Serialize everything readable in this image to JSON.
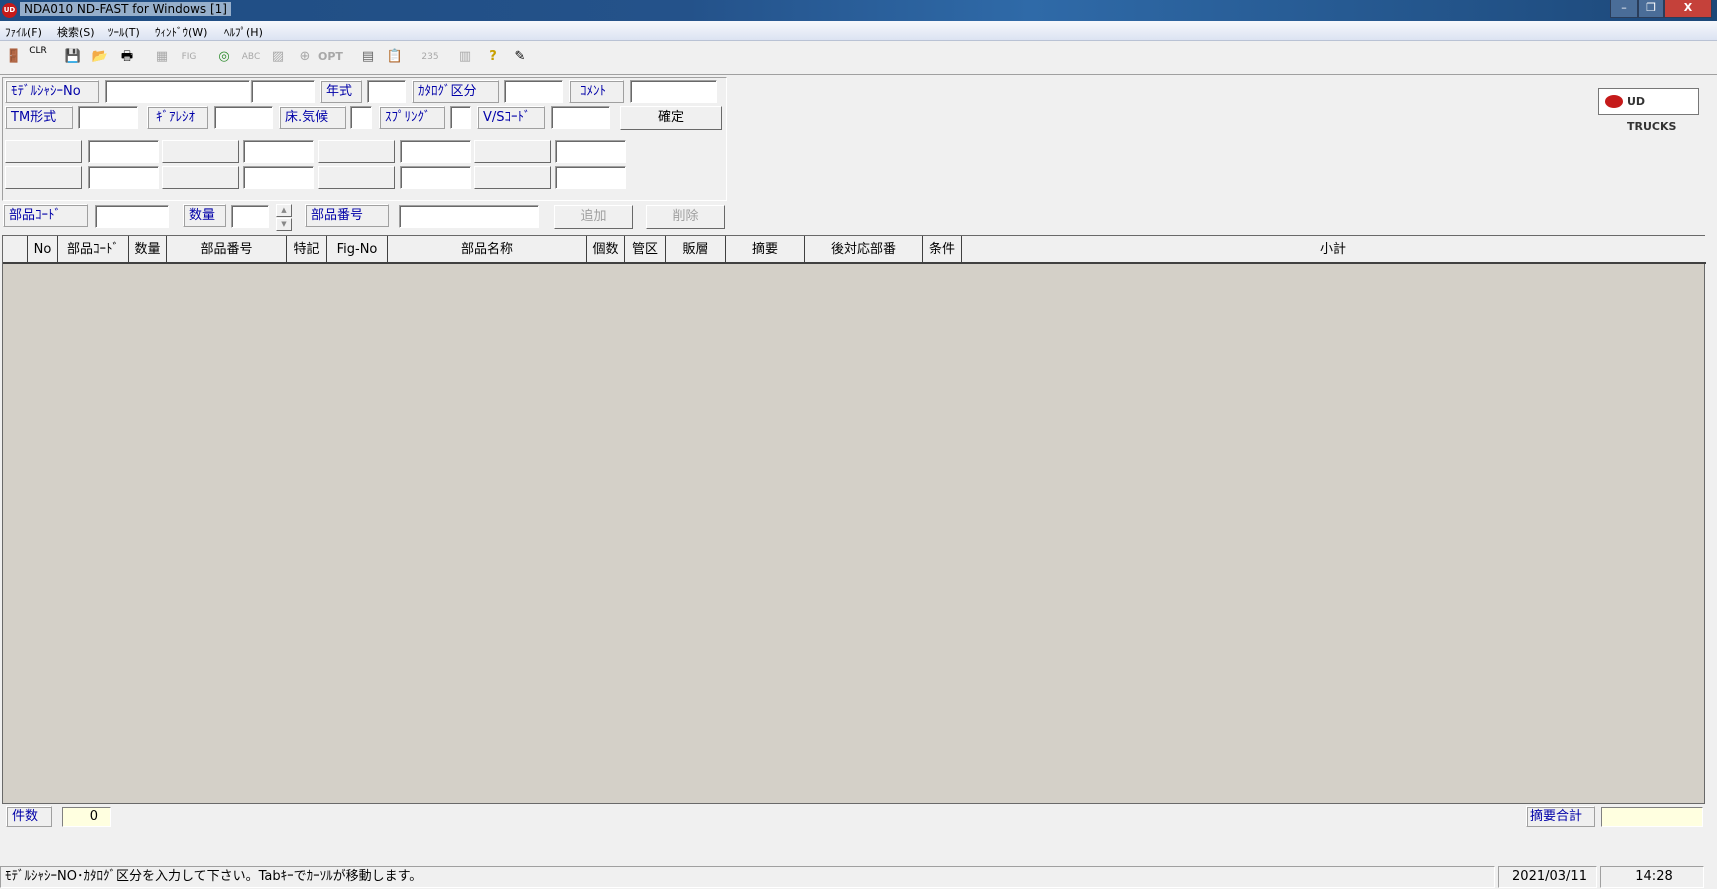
{
  "window": {
    "title": "NDA010 ND-FAST for Windows [1]",
    "app_icon": "UD",
    "minimize": "–",
    "restore": "❐",
    "close": "X"
  },
  "menu": [
    "ﾌｧｲﾙ(F)",
    "検索(S)",
    "ﾂｰﾙ(T)",
    "ｳｨﾝﾄﾞｳ(W)",
    "ﾍﾙﾌﾟ(H)"
  ],
  "toolbar": {
    "clr": "CLR",
    "abc": "ABC",
    "opt": "OPT",
    "num": "235",
    "logo": "UD TRUCKS"
  },
  "form": {
    "model_chassis_label": "ﾓﾃﾞﾙｼｬｼｰNo",
    "model_chassis_value": "",
    "model_chassis_value2": "",
    "year_label": "年式",
    "year_value": "",
    "catalog_label": "ｶﾀﾛｸﾞ区分",
    "catalog_value": "",
    "comment_label": "ｺﾒﾝﾄ",
    "comment_value": "",
    "tm_label": "TM形式",
    "tm_value": "",
    "gear_label": "ｷﾞｱﾚｼｵ",
    "gear_value": "",
    "floor_label": "床.気候",
    "floor_value": "",
    "spring_label": "ｽﾌﾟﾘﾝｸﾞ",
    "spring_value": "",
    "vs_label": "V/Sｺｰﾄﾞ",
    "vs_value": "",
    "confirm_button": "確定"
  },
  "parts": {
    "code_label": "部品ｺｰﾄﾞ",
    "code_value": "",
    "qty_label": "数量",
    "qty_value": "",
    "number_label": "部品番号",
    "number_value": "",
    "add_button": "追加",
    "delete_button": "削除"
  },
  "grid": {
    "columns": [
      "",
      "No",
      "部品ｺｰﾄﾞ",
      "数量",
      "部品番号",
      "特記",
      "Fig-No",
      "部品名称",
      "個数",
      "管区",
      "販層",
      "摘要",
      "後対応部番",
      "条件",
      "小計"
    ],
    "rows": []
  },
  "footer": {
    "count_label": "件数",
    "count_value": "0",
    "summary_total_label": "摘要合計",
    "summary_total_value": ""
  },
  "status": {
    "message": "ﾓﾃﾞﾙｼｬｼｰNO･ｶﾀﾛｸﾞ区分を入力して下さい。Tabｷｰでｶｰｿﾙが移動します。",
    "date": "2021/03/11",
    "time": "14:28"
  }
}
